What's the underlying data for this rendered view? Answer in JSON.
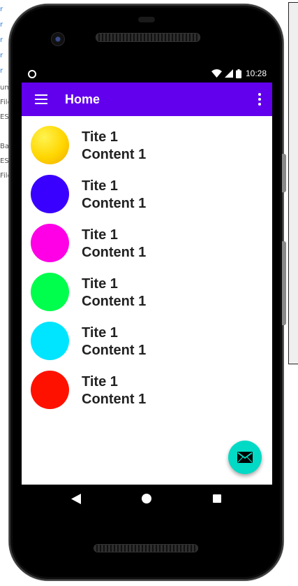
{
  "background_ide": {
    "fragments": [
      "r",
      "r",
      "r",
      "r",
      "r",
      "r",
      "um",
      "File",
      "ES",
      "Ba",
      "ES",
      "File"
    ]
  },
  "status_bar": {
    "time": "10:28",
    "icons": [
      "circle-status-icon",
      "wifi-icon",
      "signal-icon",
      "battery-icon"
    ]
  },
  "app_bar": {
    "title": "Home",
    "color": "#6200ee",
    "icons": [
      "menu-icon",
      "overflow-icon"
    ]
  },
  "list": {
    "items": [
      {
        "title": "Tite 1",
        "content": "Content 1",
        "color": "#ffd600"
      },
      {
        "title": "Tite 1",
        "content": "Content 1",
        "color": "#3a00ff"
      },
      {
        "title": "Tite 1",
        "content": "Content 1",
        "color": "#ff00e6"
      },
      {
        "title": "Tite 1",
        "content": "Content 1",
        "color": "#00ff4c"
      },
      {
        "title": "Tite 1",
        "content": "Content 1",
        "color": "#00e5ff"
      },
      {
        "title": "Tite 1",
        "content": "Content 1",
        "color": "#ff1100"
      }
    ]
  },
  "fab": {
    "icon": "mail-icon",
    "color": "#03dac5"
  },
  "nav_bar": {
    "icons": [
      "back-icon",
      "home-icon",
      "recent-apps-icon"
    ]
  }
}
